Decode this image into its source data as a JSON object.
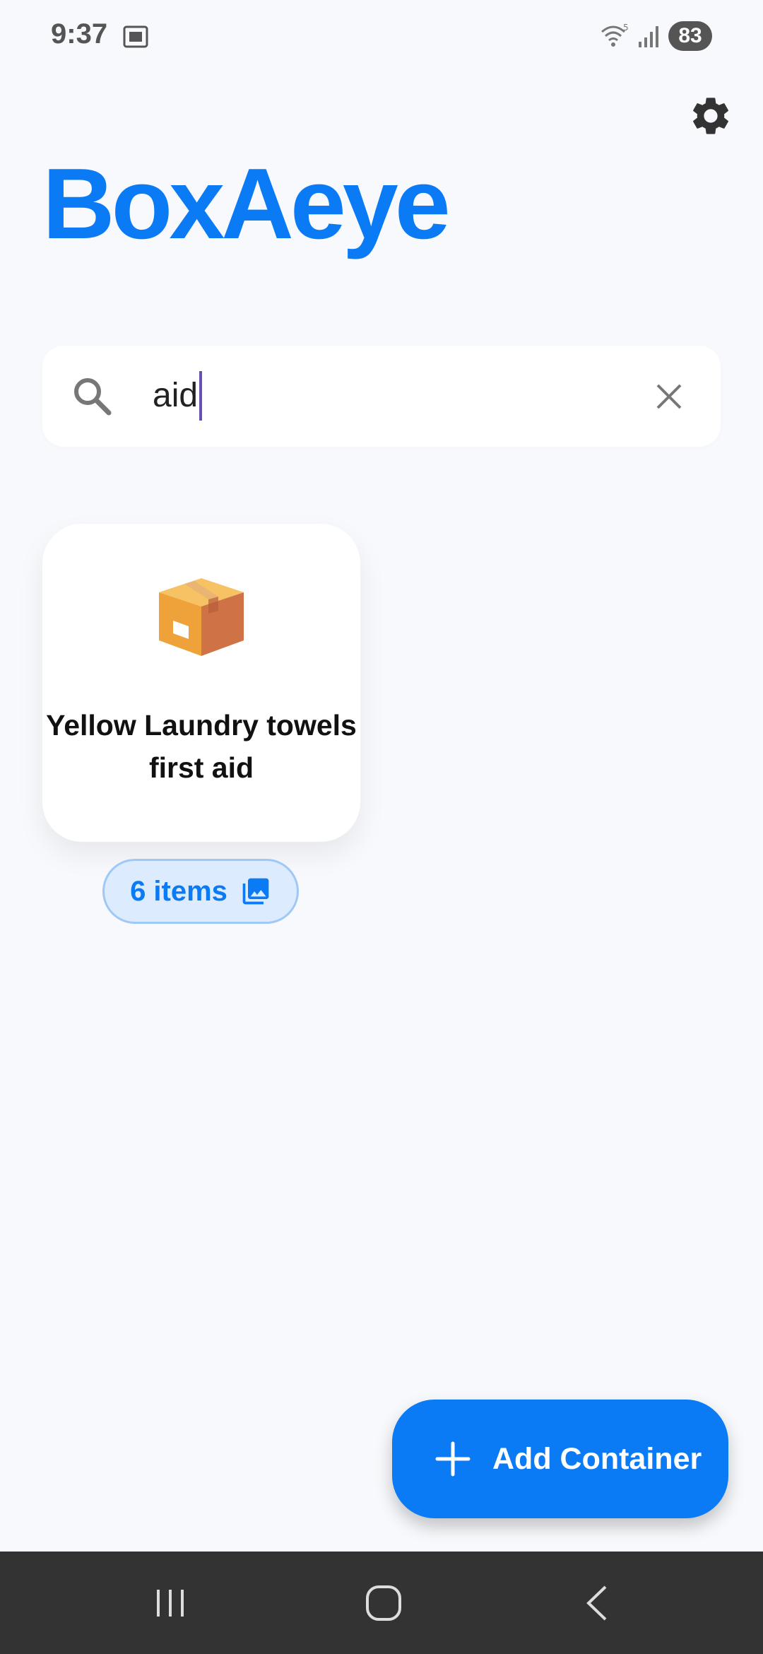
{
  "status_bar": {
    "time": "9:37",
    "battery": "83",
    "icons": [
      "screenshot-icon",
      "wifi-icon",
      "signal-icon",
      "battery-icon"
    ]
  },
  "app": {
    "title": "BoxAeye",
    "accent_color": "#0a7bf5"
  },
  "search": {
    "value": "aid",
    "icon": "search-icon",
    "clear_icon": "close-icon"
  },
  "results": [
    {
      "icon": "package-icon",
      "title": "Yellow Laundry towels first aid",
      "items_label": "6 items",
      "badge_icon": "gallery-icon"
    }
  ],
  "fab": {
    "label": "Add Container",
    "icon": "plus-icon"
  },
  "settings": {
    "icon": "gear-icon"
  },
  "nav_bar": {
    "buttons": [
      "recent-apps-icon",
      "home-icon",
      "back-icon"
    ]
  }
}
